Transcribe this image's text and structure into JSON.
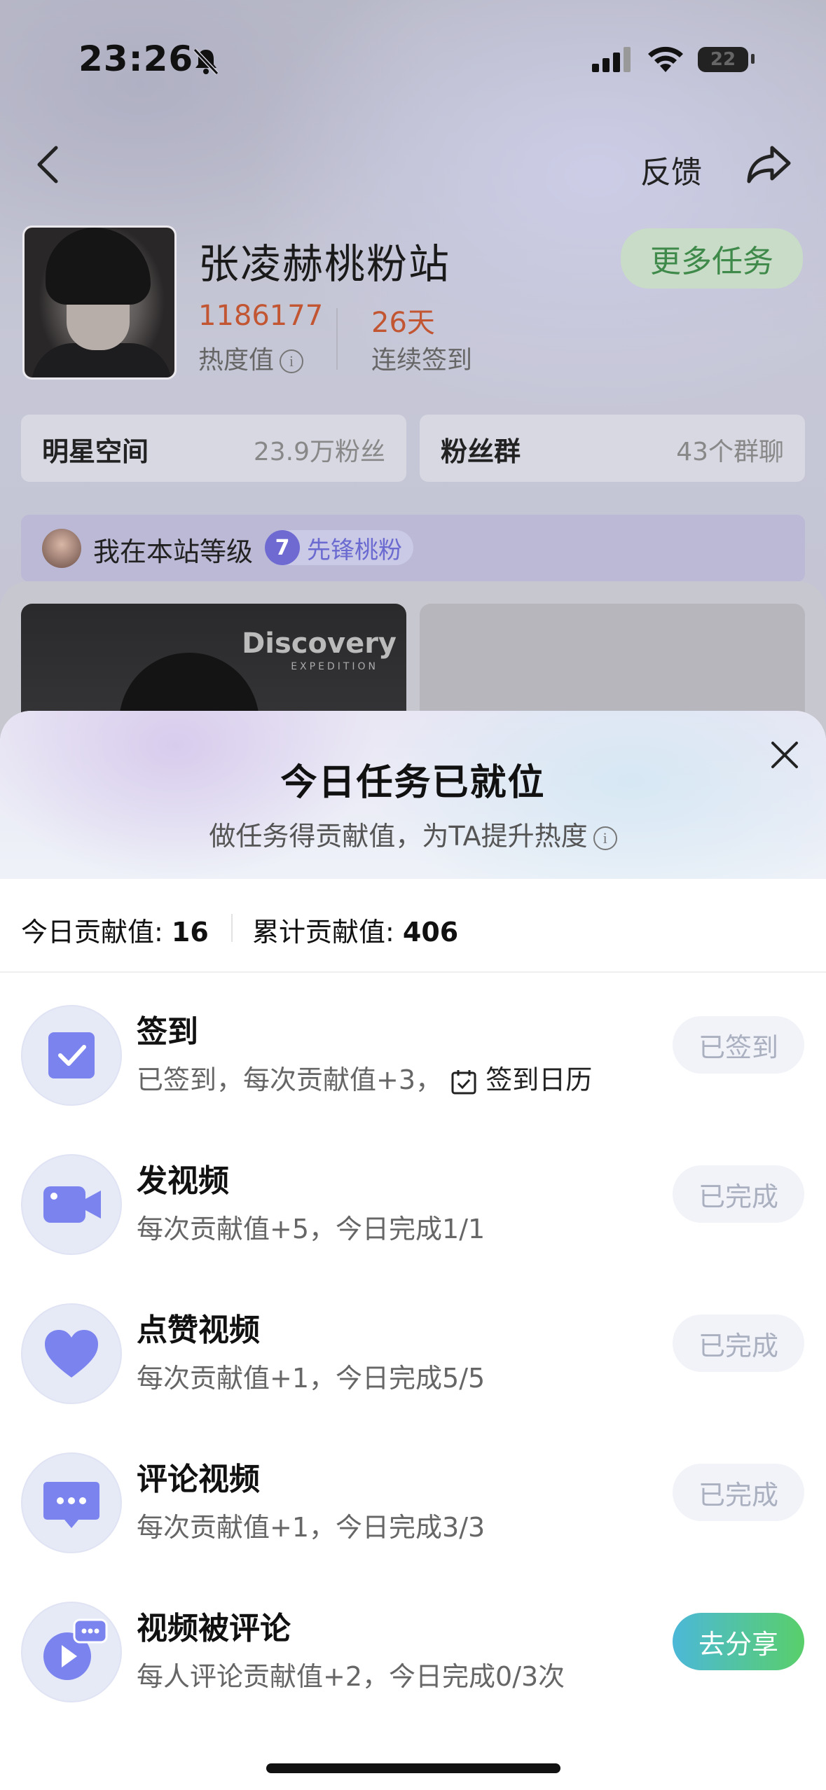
{
  "status_bar": {
    "time": "23:26",
    "battery": "22"
  },
  "nav": {
    "feedback_label": "反馈"
  },
  "profile": {
    "name": "张凌赫桃粉站",
    "more_tasks_label": "更多任务",
    "heat_value": "1186177",
    "heat_label": "热度值",
    "checkin_days": "26天",
    "checkin_label": "连续签到"
  },
  "cards": {
    "star_space": {
      "title": "明星空间",
      "value": "23.9万粉丝"
    },
    "fan_group": {
      "title": "粉丝群",
      "value": "43个群聊"
    }
  },
  "level": {
    "text": "我在本站等级",
    "number": "7",
    "name": "先锋桃粉"
  },
  "gallery": {
    "thumb1_logo": "Discovery",
    "thumb1_logo_sub": "EXPEDITION"
  },
  "sheet": {
    "title": "今日任务已就位",
    "subtitle": "做任务得贡献值，为TA提升热度",
    "today_label": "今日贡献值:",
    "today_value": "16",
    "total_label": "累计贡献值:",
    "total_value": "406"
  },
  "tasks": [
    {
      "icon": "checkbox-icon",
      "title": "签到",
      "desc": "已签到，每次贡献值+3，",
      "link": "签到日历",
      "button": "已签到",
      "active": false
    },
    {
      "icon": "video-camera-icon",
      "title": "发视频",
      "desc": "每次贡献值+5，今日完成1/1",
      "button": "已完成",
      "active": false
    },
    {
      "icon": "heart-icon",
      "title": "点赞视频",
      "desc": "每次贡献值+1，今日完成5/5",
      "button": "已完成",
      "active": false
    },
    {
      "icon": "comment-icon",
      "title": "评论视频",
      "desc": "每次贡献值+1，今日完成3/3",
      "button": "已完成",
      "active": false
    },
    {
      "icon": "video-commented-icon",
      "title": "视频被评论",
      "desc": "每人评论贡献值+2，今日完成0/3次",
      "button": "去分享",
      "active": true
    }
  ],
  "colors": {
    "accent_red": "#c25532",
    "green_button": "#59cf6a",
    "icon_purple": "#7b83ee"
  }
}
